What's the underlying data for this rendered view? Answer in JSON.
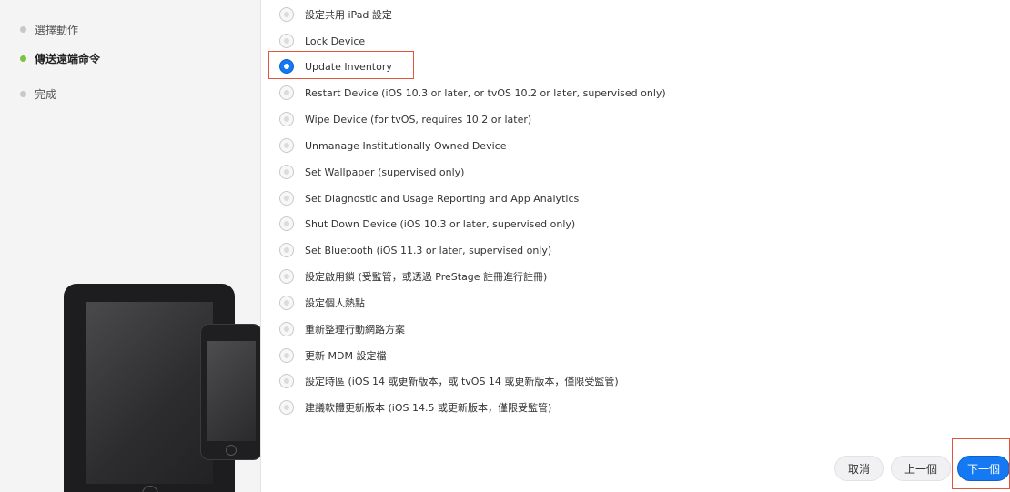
{
  "steps": [
    {
      "label": "選擇動作",
      "active": false
    },
    {
      "label": "傳送遠端命令",
      "active": true
    },
    {
      "label": "完成",
      "active": false
    }
  ],
  "options": [
    {
      "label": "設定共用 iPad 設定",
      "checked": false
    },
    {
      "label": "Lock Device",
      "checked": false
    },
    {
      "label": "Update Inventory",
      "checked": true
    },
    {
      "label": "Restart Device (iOS 10.3 or later, or tvOS 10.2 or later, supervised only)",
      "checked": false
    },
    {
      "label": "Wipe Device (for tvOS, requires 10.2 or later)",
      "checked": false
    },
    {
      "label": "Unmanage Institutionally Owned Device",
      "checked": false
    },
    {
      "label": "Set Wallpaper (supervised only)",
      "checked": false
    },
    {
      "label": "Set Diagnostic and Usage Reporting and App Analytics",
      "checked": false
    },
    {
      "label": "Shut Down Device (iOS 10.3 or later, supervised only)",
      "checked": false
    },
    {
      "label": "Set Bluetooth (iOS 11.3 or later, supervised only)",
      "checked": false
    },
    {
      "label": "設定啟用鎖 (受監管，或透過 PreStage 註冊進行註冊)",
      "checked": false
    },
    {
      "label": "設定個人熱點",
      "checked": false
    },
    {
      "label": "重新整理行動網路方案",
      "checked": false
    },
    {
      "label": "更新 MDM 設定檔",
      "checked": false
    },
    {
      "label": "設定時區 (iOS 14 或更新版本，或 tvOS 14 或更新版本，僅限受監管)",
      "checked": false
    },
    {
      "label": "建議軟體更新版本 (iOS 14.5 或更新版本，僅限受監管)",
      "checked": false
    }
  ],
  "footer": {
    "cancel_label": "取消",
    "back_label": "上一個",
    "next_label": "下一個"
  },
  "colors": {
    "accent": "#1479f2",
    "active_step_dot": "#7cc243",
    "highlight_border": "#e2553d"
  },
  "icons": {
    "device_illustration": "ipad-and-iphone-illustration"
  }
}
